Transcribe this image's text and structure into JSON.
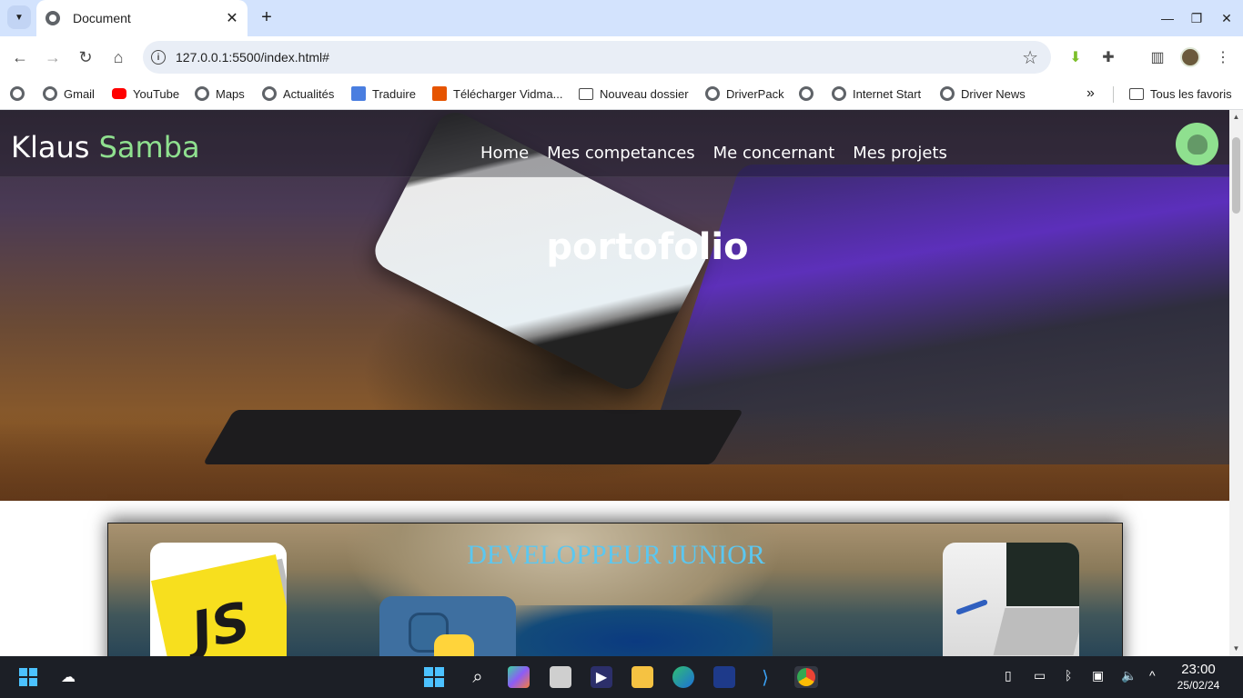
{
  "browser": {
    "tab_title": "Document",
    "url": "127.0.0.1:5500/index.html#",
    "bookmarks": [
      {
        "label": "",
        "icon": "globe-icon"
      },
      {
        "label": "Gmail",
        "icon": "globe-icon"
      },
      {
        "label": "YouTube",
        "icon": "youtube-icon"
      },
      {
        "label": "Maps",
        "icon": "globe-icon"
      },
      {
        "label": "Actualités",
        "icon": "globe-icon"
      },
      {
        "label": "Traduire",
        "icon": "translate-icon"
      },
      {
        "label": "Télécharger Vidma...",
        "icon": "vidmate-icon"
      },
      {
        "label": "Nouveau dossier",
        "icon": "folder-icon"
      },
      {
        "label": "DriverPack",
        "icon": "globe-icon"
      },
      {
        "label": "",
        "icon": "globe-icon"
      },
      {
        "label": "Internet Start",
        "icon": "globe-icon"
      },
      {
        "label": "Driver News",
        "icon": "globe-icon"
      }
    ],
    "more_bookmarks": "»",
    "all_bookmarks": "Tous les favoris"
  },
  "site": {
    "logo_first": "Klaus",
    "logo_second": "Samba",
    "nav": [
      "Home",
      "Mes competances",
      "Me concernant",
      "Mes projets"
    ],
    "hero_title": "portofolio",
    "card_title": "DEVELOPPEUR JUNIOR",
    "js_logo_text": "JS"
  },
  "taskbar": {
    "time": "23:00",
    "date": "25/02/24"
  },
  "colors": {
    "accent_green": "#8fe08f",
    "card_title_blue": "#5bc7f0",
    "js_yellow": "#f7df1e"
  }
}
